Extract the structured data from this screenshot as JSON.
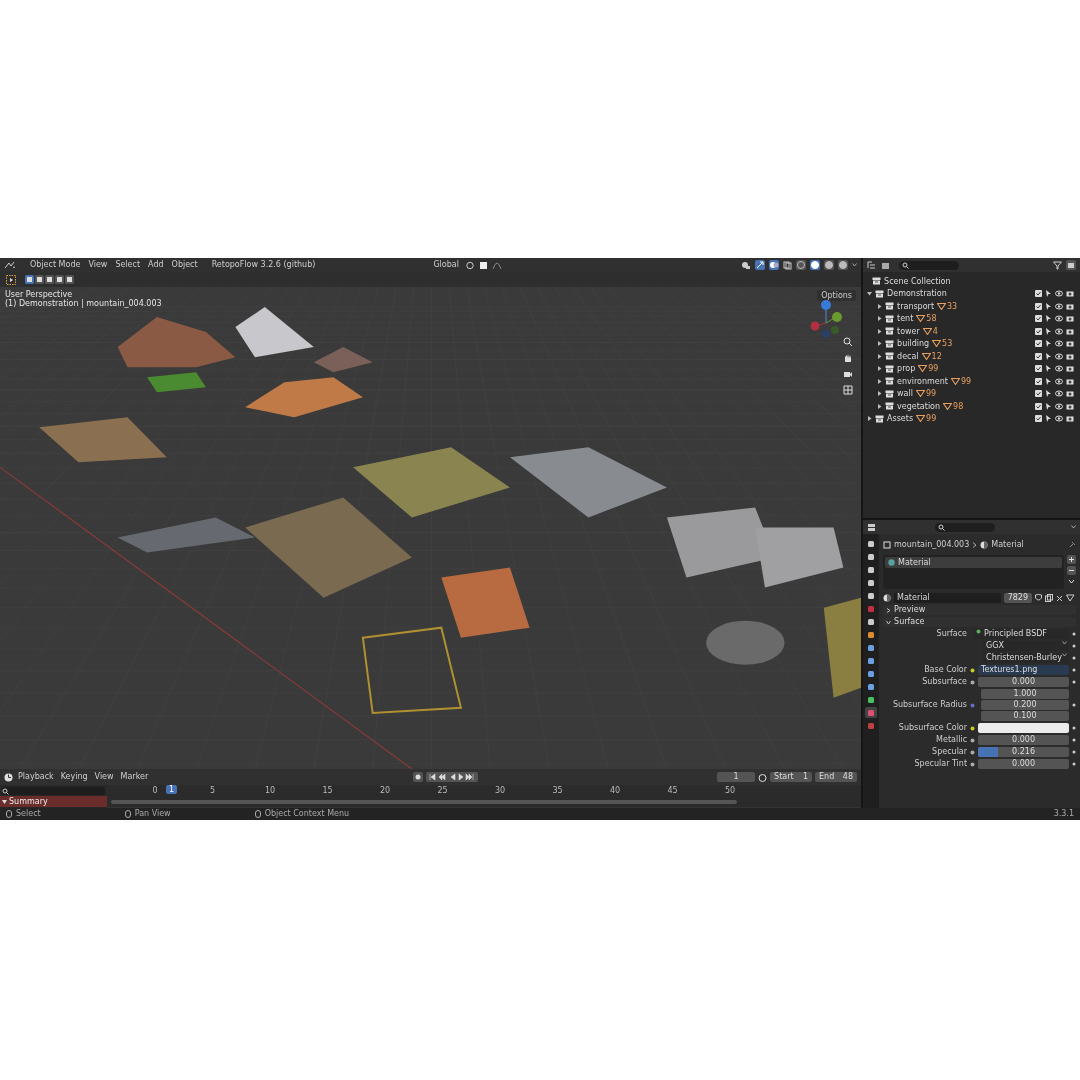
{
  "viewport_header": {
    "mode": "Object Mode",
    "menus": [
      "View",
      "Select",
      "Add",
      "Object"
    ],
    "addon_menu": "RetopoFlow 3.2.6 (github)",
    "orientation": "Global",
    "shading_modes": [
      {
        "selected": false
      },
      {
        "selected": true
      },
      {
        "selected": false
      },
      {
        "selected": false
      }
    ]
  },
  "tool_header": {
    "select_modes": [
      {
        "selected": true
      },
      {
        "selected": false
      },
      {
        "selected": false
      },
      {
        "selected": false
      },
      {
        "selected": false
      }
    ]
  },
  "viewport": {
    "overlay_lines": [
      "User Perspective",
      "(1) Demonstration | mountain_004.003"
    ],
    "options_button": "Options"
  },
  "timeline": {
    "menus": [
      "Playback",
      "Keying",
      "View",
      "Marker"
    ],
    "current_frame": "1",
    "start_label": "Start",
    "start": "1",
    "end_label": "End",
    "end": "48",
    "ruler_ticks": [
      "0",
      "5",
      "10",
      "15",
      "20",
      "25",
      "30",
      "35",
      "40",
      "45",
      "50"
    ],
    "playhead": "1",
    "channels": [
      "Summary"
    ]
  },
  "status_bar": {
    "hints": [
      "Select",
      "Pan View",
      "Object Context Menu"
    ],
    "version": "3.3.1"
  },
  "outliner": {
    "root": "Scene Collection",
    "items": [
      {
        "name": "Demonstration",
        "expanded": true,
        "checked": true,
        "children": [
          {
            "name": "transport",
            "count": "33",
            "expanded": false,
            "checked": true
          },
          {
            "name": "tent",
            "count": "58",
            "expanded": false,
            "checked": true
          },
          {
            "name": "tower",
            "count": "4",
            "expanded": false,
            "checked": true
          },
          {
            "name": "building",
            "count": "53",
            "expanded": false,
            "checked": true
          },
          {
            "name": "decal",
            "count": "12",
            "expanded": false,
            "checked": true
          },
          {
            "name": "prop",
            "count": "99",
            "expanded": false,
            "checked": true
          },
          {
            "name": "environment",
            "count": "99",
            "expanded": false,
            "checked": true
          },
          {
            "name": "wall",
            "count": "99",
            "expanded": false,
            "checked": true
          },
          {
            "name": "vegetation",
            "count": "98",
            "expanded": false,
            "checked": true
          }
        ]
      },
      {
        "name": "Assets",
        "count": "99",
        "expanded": false,
        "checked": true
      }
    ]
  },
  "properties": {
    "tabs": [
      {
        "selected": false
      },
      {
        "selected": false
      },
      {
        "selected": false
      },
      {
        "selected": false
      },
      {
        "selected": false
      },
      {
        "selected": false
      },
      {
        "selected": false
      },
      {
        "selected": false
      },
      {
        "selected": false
      },
      {
        "selected": false
      },
      {
        "selected": false
      },
      {
        "selected": false
      },
      {
        "selected": false
      },
      {
        "selected": true
      },
      {
        "selected": false
      }
    ],
    "object_name": "mountain_004.003",
    "context": "Material",
    "slots": [
      {
        "name": "Material",
        "selected": true
      }
    ],
    "material_name": "Material",
    "users": "7829",
    "panels": [
      {
        "title": "Preview",
        "expanded": false
      },
      {
        "title": "Surface",
        "expanded": true
      }
    ],
    "fields": [
      {
        "kind": "shader",
        "label": "Surface",
        "value": "Principled BSDF"
      },
      {
        "kind": "dropdown",
        "value": "GGX"
      },
      {
        "kind": "dropdown",
        "value": "Christensen-Burley"
      },
      {
        "kind": "texture",
        "label": "Base Color",
        "value": "Textures1.png"
      },
      {
        "kind": "number",
        "label": "Subsurface",
        "value": "0.000"
      },
      {
        "kind": "vector",
        "label": "Subsurface Radius",
        "values": [
          "1.000",
          "0.200",
          "0.100"
        ]
      },
      {
        "kind": "color",
        "label": "Subsurface Color",
        "color": "#ececec"
      },
      {
        "kind": "number",
        "label": "Metallic",
        "value": "0.000"
      },
      {
        "kind": "slider",
        "label": "Specular",
        "value": "0.216",
        "level": 0.216
      },
      {
        "kind": "number",
        "label": "Specular Tint",
        "value": "0.000"
      }
    ]
  }
}
